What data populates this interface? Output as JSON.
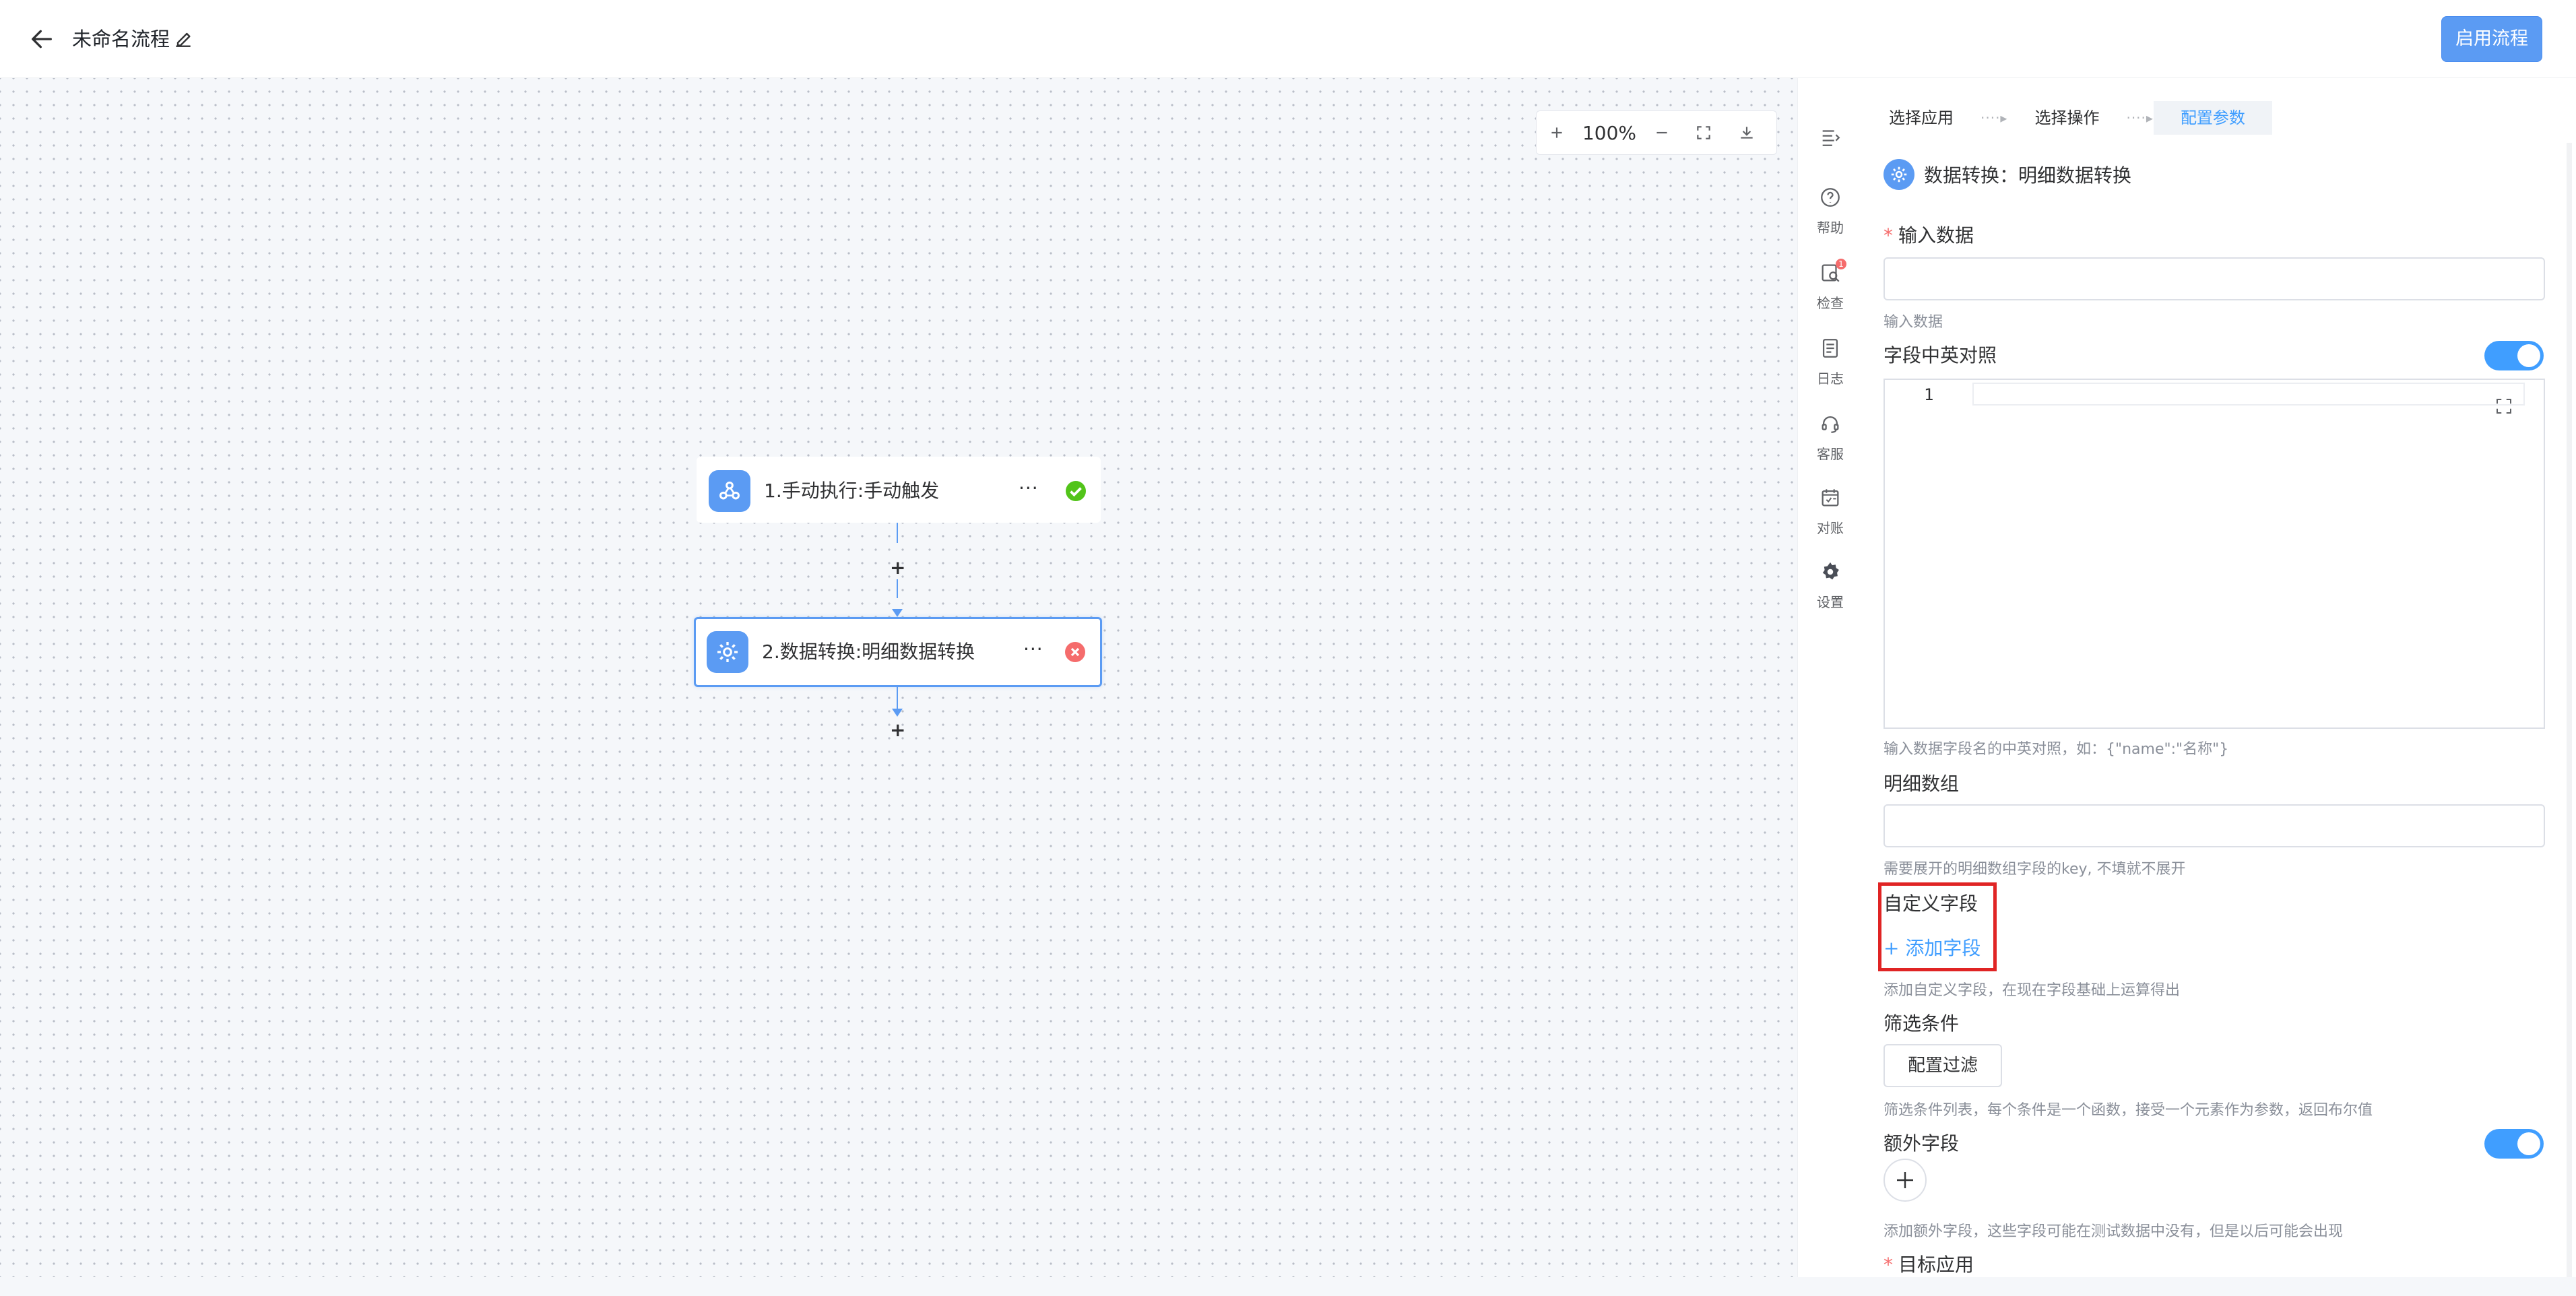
{
  "header": {
    "title": "未命名流程",
    "enable_button": "启用流程"
  },
  "canvas": {
    "zoom_level": "100%",
    "nodes": [
      {
        "label": "1.手动执行:手动触发",
        "status": "success"
      },
      {
        "label": "2.数据转换:明细数据转换",
        "status": "error",
        "selected": true
      }
    ]
  },
  "toolbar": {
    "items": [
      {
        "label": "帮助",
        "icon": "help-icon"
      },
      {
        "label": "检查",
        "icon": "check-icon",
        "badge": "1"
      },
      {
        "label": "日志",
        "icon": "log-icon"
      },
      {
        "label": "客服",
        "icon": "headset-icon"
      },
      {
        "label": "对账",
        "icon": "reconcile-icon"
      },
      {
        "label": "设置",
        "icon": "gear-icon"
      }
    ]
  },
  "panel": {
    "steps": [
      "选择应用",
      "选择操作",
      "配置参数"
    ],
    "active_step": "配置参数",
    "title": "数据转换：明细数据转换",
    "fields": {
      "input_data": {
        "label": "输入数据",
        "required": true,
        "value": "",
        "help": "输入数据"
      },
      "mapping": {
        "label": "字段中英对照",
        "toggle": true,
        "line_number": "1",
        "help": "输入数据字段名的中英对照，如：{\"name\":\"名称\"}"
      },
      "detail_array": {
        "label": "明细数组",
        "value": "",
        "help": "需要展开的明细数组字段的key, 不填就不展开"
      },
      "custom_field": {
        "label": "自定义字段",
        "add_link": "+ 添加字段",
        "help": "添加自定义字段，在现在字段基础上运算得出"
      },
      "filter": {
        "label": "筛选条件",
        "button": "配置过滤",
        "help": "筛选条件列表，每个条件是一个函数，接受一个元素作为参数，返回布尔值"
      },
      "extra_field": {
        "label": "额外字段",
        "toggle": true,
        "help": "添加额外字段，这些字段可能在测试数据中没有，但是以后可能会出现"
      },
      "target_app": {
        "label": "目标应用",
        "required": true
      }
    }
  },
  "colors": {
    "accent": "#409eff",
    "node_icon": "#5b9bf3",
    "success": "#52c41a",
    "error": "#f56c6c",
    "highlight": "#e02424"
  }
}
